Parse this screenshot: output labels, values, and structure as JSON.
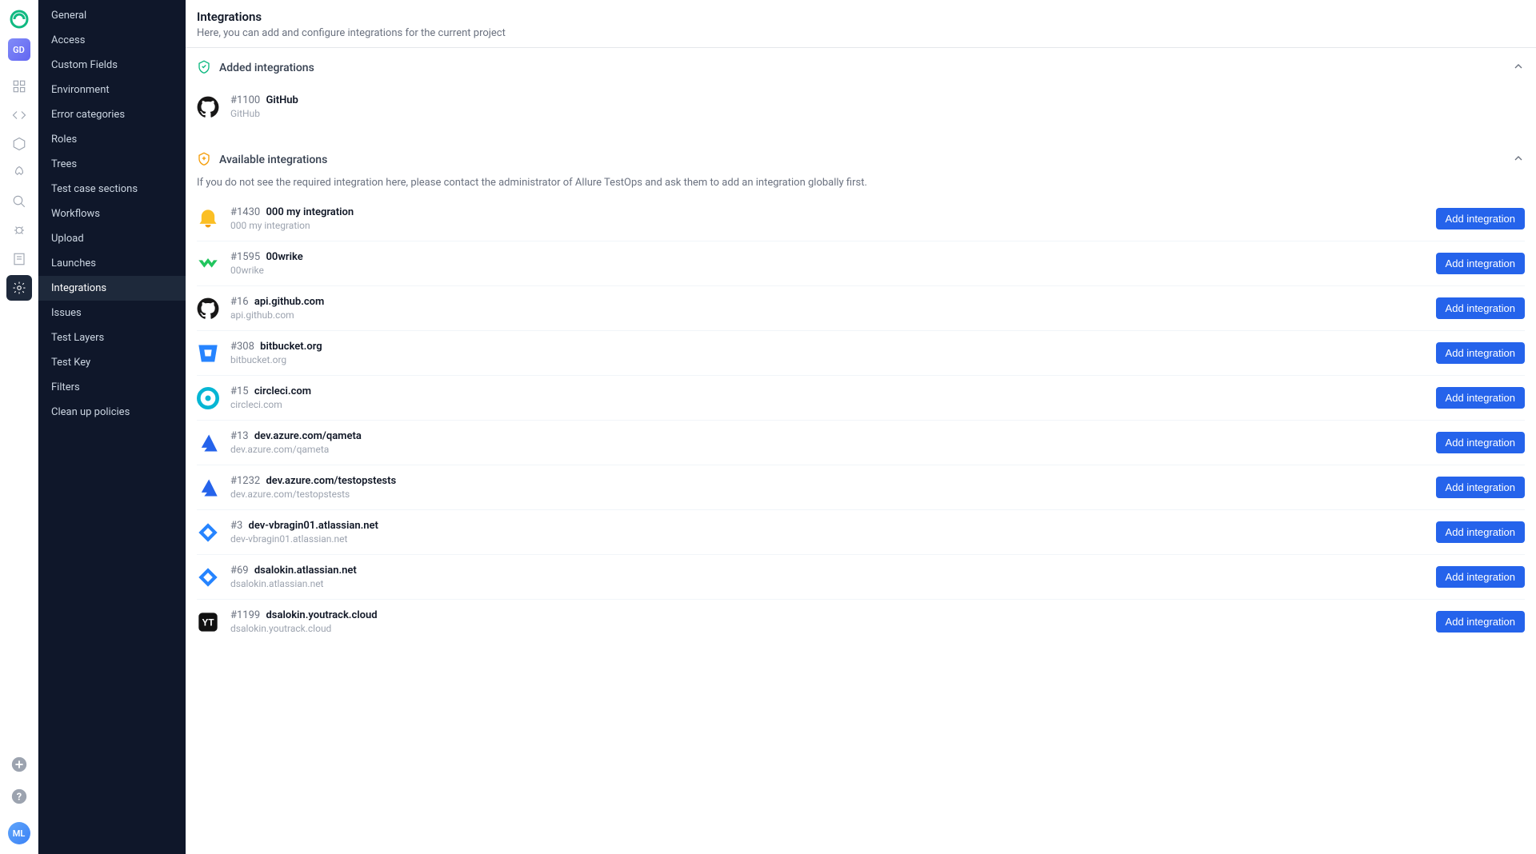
{
  "project_badge": "GD",
  "user_avatar": "ML",
  "sidebar": [
    {
      "label": "General"
    },
    {
      "label": "Access"
    },
    {
      "label": "Custom Fields"
    },
    {
      "label": "Environment"
    },
    {
      "label": "Error categories"
    },
    {
      "label": "Roles"
    },
    {
      "label": "Trees"
    },
    {
      "label": "Test case sections"
    },
    {
      "label": "Workflows"
    },
    {
      "label": "Upload"
    },
    {
      "label": "Launches"
    },
    {
      "label": "Integrations",
      "active": true
    },
    {
      "label": "Issues"
    },
    {
      "label": "Test Layers"
    },
    {
      "label": "Test Key"
    },
    {
      "label": "Filters"
    },
    {
      "label": "Clean up policies"
    }
  ],
  "header": {
    "title": "Integrations",
    "subtitle": "Here, you can add and configure integrations for the current project"
  },
  "added": {
    "title": "Added integrations",
    "items": [
      {
        "id": "#1100",
        "name": "GitHub",
        "sub": "GitHub",
        "icon": "github"
      }
    ]
  },
  "available": {
    "title": "Available integrations",
    "desc": "If you do not see the required integration here, please contact the administrator of Allure TestOps and ask them to add an integration globally first.",
    "button_label": "Add integration",
    "items": [
      {
        "id": "#1430",
        "name": "000 my integration",
        "sub": "000 my integration",
        "icon": "bell"
      },
      {
        "id": "#1595",
        "name": "00wrike",
        "sub": "00wrike",
        "icon": "wrike"
      },
      {
        "id": "#16",
        "name": "api.github.com",
        "sub": "api.github.com",
        "icon": "github"
      },
      {
        "id": "#308",
        "name": "bitbucket.org",
        "sub": "bitbucket.org",
        "icon": "bitbucket"
      },
      {
        "id": "#15",
        "name": "circleci.com",
        "sub": "circleci.com",
        "icon": "circleci"
      },
      {
        "id": "#13",
        "name": "dev.azure.com/qameta",
        "sub": "dev.azure.com/qameta",
        "icon": "azure"
      },
      {
        "id": "#1232",
        "name": "dev.azure.com/testopstests",
        "sub": "dev.azure.com/testopstests",
        "icon": "azure"
      },
      {
        "id": "#3",
        "name": "dev-vbragin01.atlassian.net",
        "sub": "dev-vbragin01.atlassian.net",
        "icon": "jira"
      },
      {
        "id": "#69",
        "name": "dsalokin.atlassian.net",
        "sub": "dsalokin.atlassian.net",
        "icon": "jira"
      },
      {
        "id": "#1199",
        "name": "dsalokin.youtrack.cloud",
        "sub": "dsalokin.youtrack.cloud",
        "icon": "youtrack"
      }
    ]
  }
}
